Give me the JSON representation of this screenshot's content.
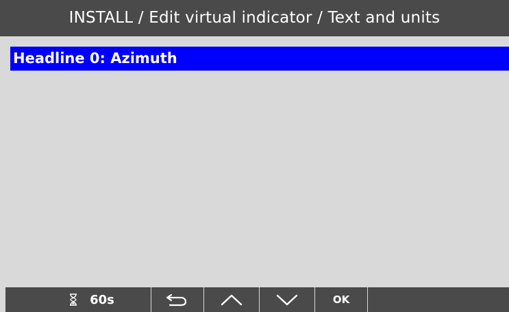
{
  "header": {
    "title": "INSTALL / Edit virtual indicator / Text and units"
  },
  "list": {
    "items": [
      {
        "label": "Headline 0: Azimuth",
        "selected": true
      }
    ]
  },
  "footer": {
    "timer_icon": "hourglass-icon",
    "timer_value": "60s",
    "back_icon": "back-arrow-icon",
    "up_icon": "chevron-up-icon",
    "down_icon": "chevron-down-icon",
    "ok_label": "OK"
  },
  "colors": {
    "bar": "#4a4a4a",
    "background": "#d9d9d9",
    "selection": "#0000ff",
    "text": "#ffffff"
  }
}
